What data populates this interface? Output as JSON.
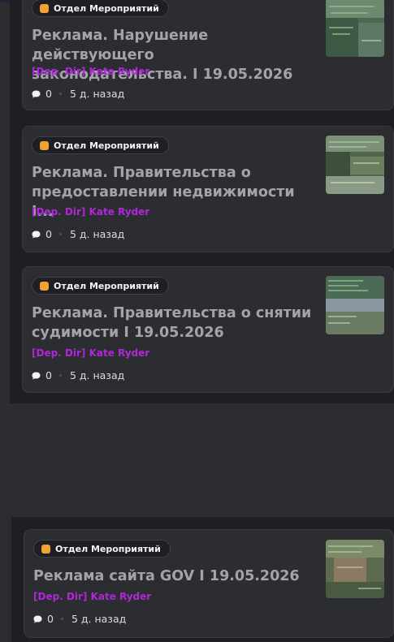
{
  "posts": [
    {
      "tag": "Отдел Мероприятий",
      "title": "Реклама. Нарушение действующего законодательства. I 19.05.2026",
      "author": "[Dep. Dir] Kate Ryder",
      "comments": "0",
      "time": "5 д. назад"
    },
    {
      "tag": "Отдел Мероприятий",
      "title": "Реклама. Правительства о предоставлении недвижимости I...",
      "author": "[Dep. Dir] Kate Ryder",
      "comments": "0",
      "time": "5 д. назад"
    },
    {
      "tag": "Отдел Мероприятий",
      "title": "Реклама. Правительства о снятии судимости I 19.05.2026",
      "author": "[Dep. Dir] Kate Ryder",
      "comments": "0",
      "time": "5 д. назад"
    },
    {
      "tag": "Отдел Мероприятий",
      "title": "Реклама сайта GOV I 19.05.2026",
      "author": "[Dep. Dir] Kate Ryder",
      "comments": "0",
      "time": "5 д. назад"
    }
  ],
  "colors": {
    "background": "#2b2d31",
    "column": "#1e1f22",
    "card": "#2b2d31",
    "author": "#b027d6",
    "tag_icon": "#f0a232",
    "title": "#a2a4aa"
  },
  "icons": {
    "tag": "tag-square-icon",
    "comments": "speech-bubble-icon"
  }
}
